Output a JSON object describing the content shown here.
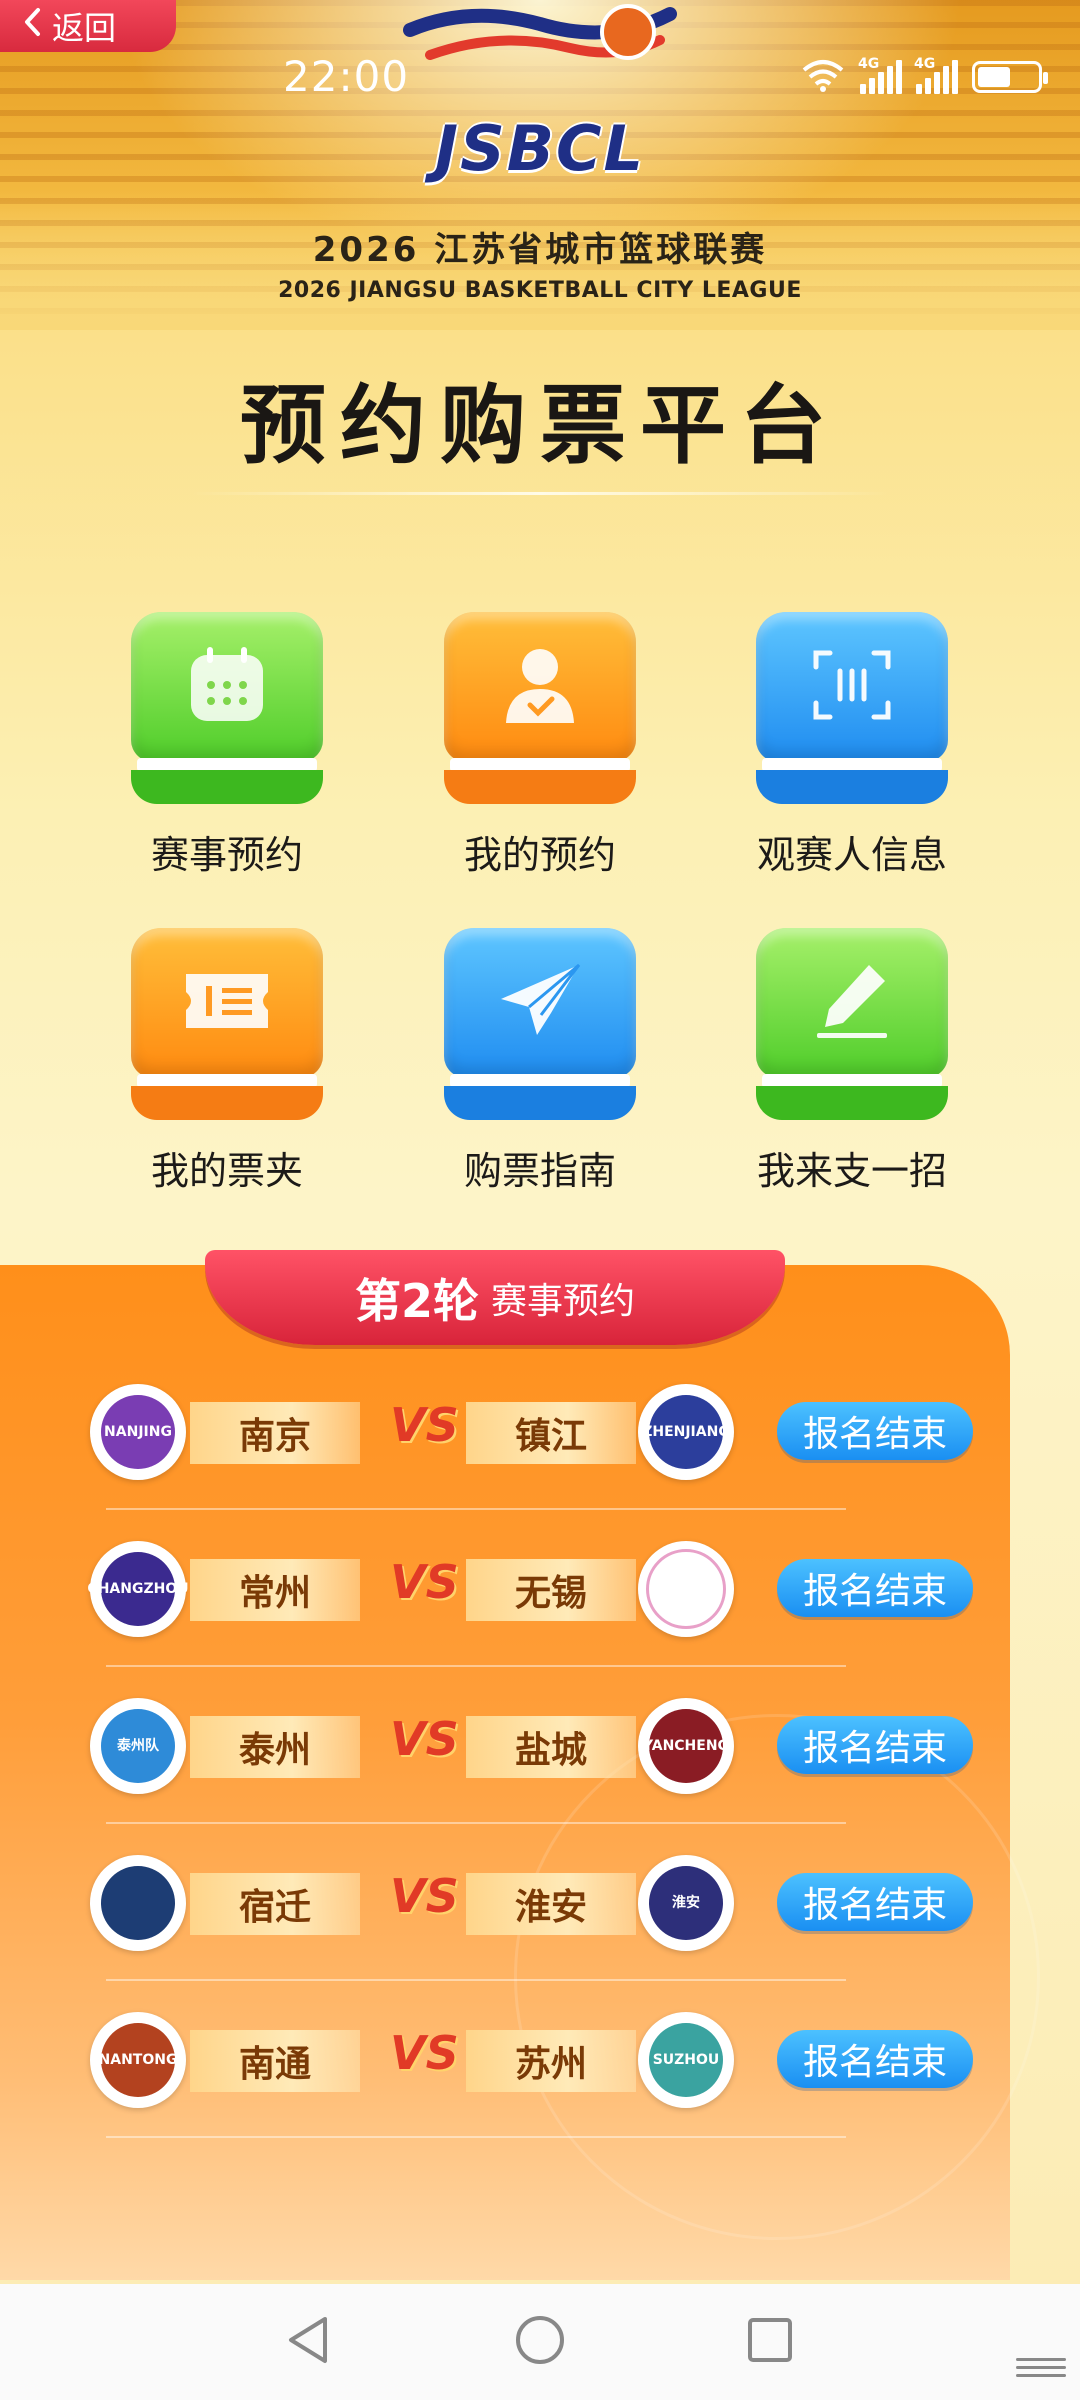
{
  "nav": {
    "back_label": "返回"
  },
  "status_bar": {
    "time": "22:00",
    "signal_1": "4G",
    "signal_2": "4G",
    "battery_level": 0.55
  },
  "header": {
    "logo_text": "JSBCL",
    "league_cn": "2026 江苏省城市篮球联赛",
    "league_en": "2026 JIANGSU  BASKETBALL CITY LEAGUE",
    "title": "预约购票平台"
  },
  "menu": [
    {
      "label": "赛事预约",
      "icon": "calendar-icon",
      "color": "green"
    },
    {
      "label": "我的预约",
      "icon": "user-check-icon",
      "color": "orange"
    },
    {
      "label": "观赛人信息",
      "icon": "scan-id-icon",
      "color": "blue"
    },
    {
      "label": "我的票夹",
      "icon": "ticket-icon",
      "color": "orange"
    },
    {
      "label": "购票指南",
      "icon": "paper-plane-icon",
      "color": "blue"
    },
    {
      "label": "我来支一招",
      "icon": "pencil-edit-icon",
      "color": "green"
    }
  ],
  "round": {
    "number_label": "第2轮",
    "title": "赛事预约"
  },
  "vs_label": "VS",
  "matches": [
    {
      "home": "南京",
      "home_logo_text": "NANJING",
      "away": "镇江",
      "away_logo_text": "ZHENJIANG",
      "status": "报名结束"
    },
    {
      "home": "常州",
      "home_logo_text": "CHANGZHOU",
      "away": "无锡",
      "away_logo_text": "",
      "status": "报名结束"
    },
    {
      "home": "泰州",
      "home_logo_text": "泰州队",
      "away": "盐城",
      "away_logo_text": "YANCHENG",
      "status": "报名结束"
    },
    {
      "home": "宿迁",
      "home_logo_text": "",
      "away": "淮安",
      "away_logo_text": "淮安",
      "status": "报名结束"
    },
    {
      "home": "南通",
      "home_logo_text": "NANTONG",
      "away": "苏州",
      "away_logo_text": "SUZHOU",
      "status": "报名结束"
    }
  ],
  "colors": {
    "accent_red": "#d8243a",
    "button_blue": "#1a8ff2",
    "panel_orange": "#ff8f1a",
    "logo_navy": "#1f2f86"
  }
}
